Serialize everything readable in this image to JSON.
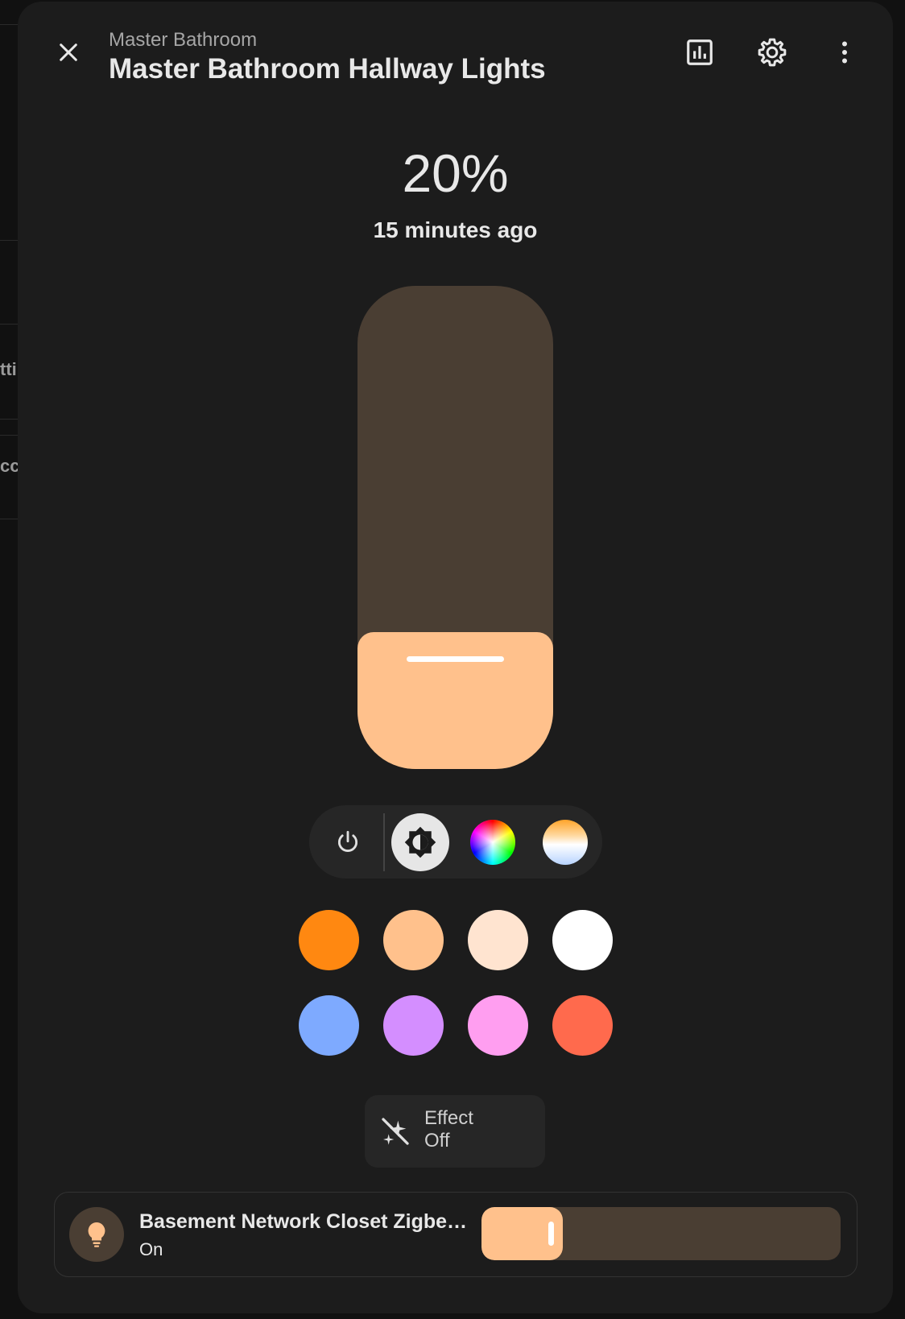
{
  "background": {
    "fragments": [
      "tti",
      "cc"
    ]
  },
  "dialog": {
    "breadcrumb": "Master Bathroom",
    "title": "Master Bathroom Hallway Lights",
    "header_icons": [
      "chart-icon",
      "gear-icon",
      "more-vertical-icon"
    ]
  },
  "state": {
    "value": "20%",
    "last_changed": "15 minutes ago",
    "brightness_percent": 20
  },
  "modes": [
    {
      "name": "power-icon",
      "selected": false
    },
    {
      "name": "brightness-icon",
      "selected": true
    },
    {
      "name": "color-wheel-icon",
      "selected": false
    },
    {
      "name": "color-temperature-icon",
      "selected": false
    }
  ],
  "colors": {
    "accent": "#ffc18c",
    "track": "#4a3e33",
    "swatches": [
      "#ff8811",
      "#ffc18c",
      "#ffe4d0",
      "#ffffff",
      "#7eaaff",
      "#d48eff",
      "#ff9ef0",
      "#ff6a4d"
    ]
  },
  "effect": {
    "label": "Effect",
    "value": "Off"
  },
  "entity": {
    "name": "Basement Network Closet Zigbee Light",
    "state": "On",
    "brightness_percent": 20
  }
}
